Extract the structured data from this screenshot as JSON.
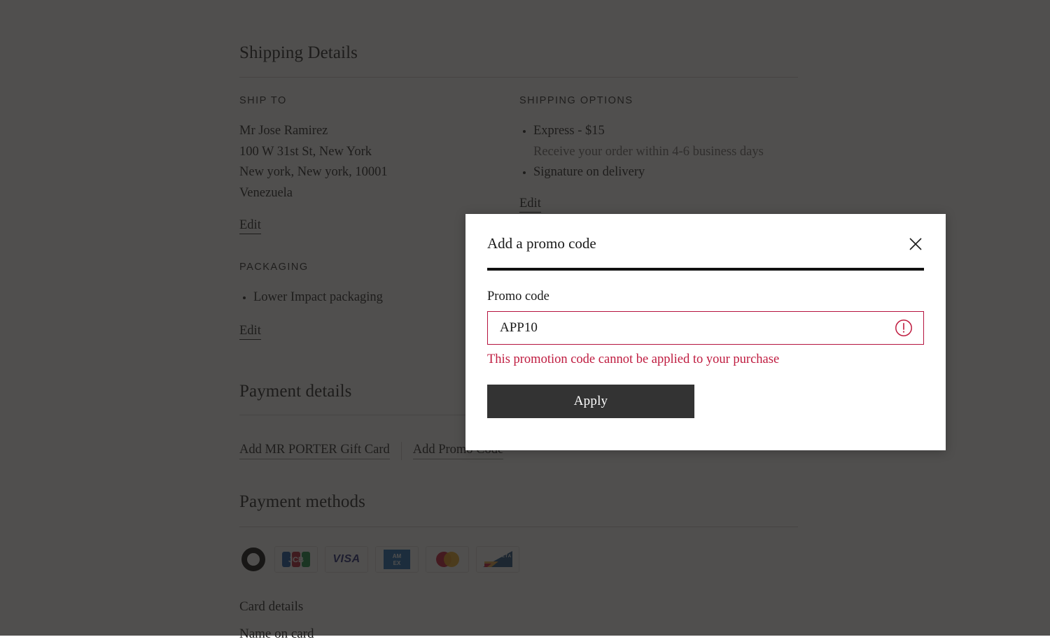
{
  "shipping": {
    "heading": "Shipping Details",
    "ship_to_label": "SHIP TO",
    "address": [
      "Mr Jose Ramirez",
      "100 W 31st St, New York",
      "New york, New york, 10001",
      "Venezuela"
    ],
    "ship_to_edit": "Edit",
    "options_label": "SHIPPING OPTIONS",
    "options": [
      "Express - $15",
      "Signature on delivery"
    ],
    "options_note": "Receive your order within 4-6 business days",
    "options_edit": "Edit",
    "packaging_label": "PACKAGING",
    "packaging_options": [
      "Lower Impact packaging"
    ],
    "packaging_edit": "Edit"
  },
  "payment_details": {
    "heading": "Payment details",
    "gift_card_link": "Add MR PORTER Gift Card",
    "promo_code_link": "Add Promo Code"
  },
  "payment_methods": {
    "heading": "Payment methods",
    "logos": [
      {
        "name": "klarna-logo",
        "label": ""
      },
      {
        "name": "jcb-logo",
        "label": "JCB"
      },
      {
        "name": "visa-logo",
        "label": "VISA"
      },
      {
        "name": "amex-logo",
        "label": "AMEX"
      },
      {
        "name": "mastercard-logo",
        "label": ""
      },
      {
        "name": "delta-logo",
        "label": "DELTA"
      }
    ],
    "card_details_heading": "Card details",
    "name_on_card_label": "Name on card"
  },
  "modal": {
    "title": "Add a promo code",
    "close_label": "Close",
    "field_label": "Promo code",
    "input_value": "APP10",
    "input_placeholder": "Promo code",
    "error_message": "This promotion code cannot be applied to your purchase",
    "apply_label": "Apply"
  },
  "colors": {
    "error_border": "#b5123e",
    "error_text": "#bf1b3f",
    "button_bg": "#333333",
    "overlay": "#1f1d1c",
    "text": "#1a1a1a"
  }
}
